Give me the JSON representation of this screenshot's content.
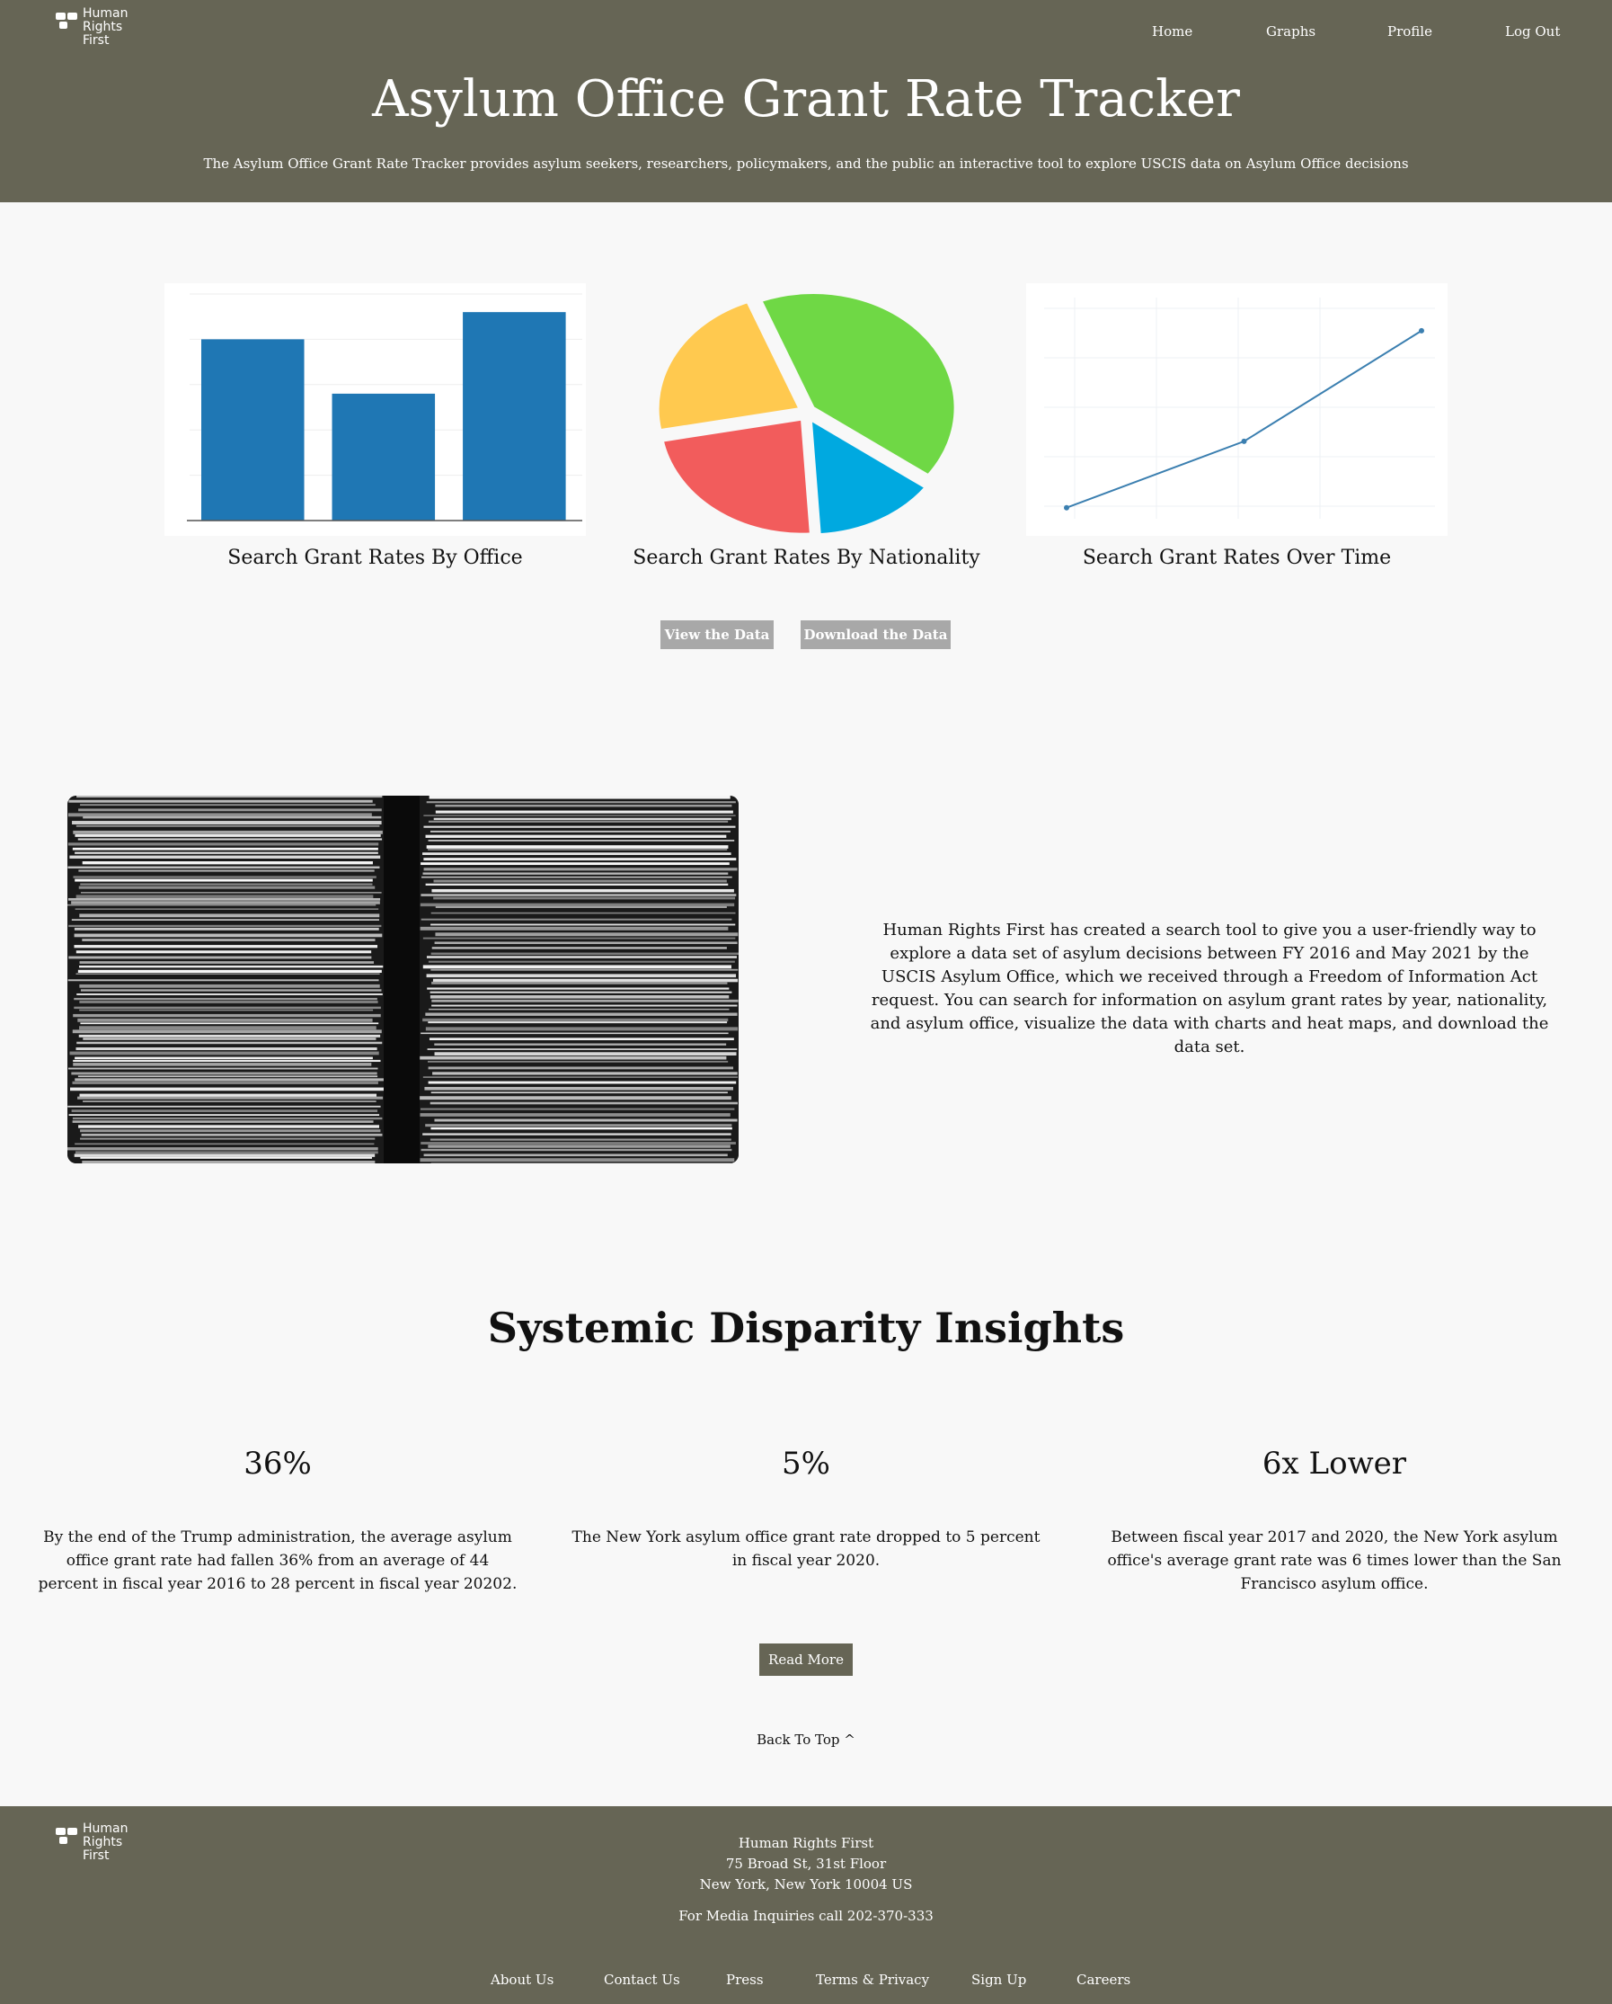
{
  "brand": {
    "logo_lines": [
      "Human",
      "Rights",
      "First"
    ]
  },
  "nav": {
    "items": [
      "Home",
      "Graphs",
      "Profile",
      "Log Out"
    ]
  },
  "hero": {
    "title": "Asylum Office Grant Rate Tracker",
    "subtitle": "The Asylum Office Grant Rate Tracker provides asylum seekers, researchers, policymakers, and the public an interactive tool to explore USCIS data on Asylum Office decisions"
  },
  "charts": {
    "office_label": "Search Grant Rates By Office",
    "nationality_label": "Search Grant Rates By Nationality",
    "time_label": "Search Grant Rates Over Time"
  },
  "chart_data": [
    {
      "type": "bar",
      "categories": [
        "",
        "",
        ""
      ],
      "values": [
        80,
        56,
        92
      ],
      "ylim": [
        0,
        100
      ],
      "grid": true,
      "colors": [
        "#1f77b4"
      ]
    },
    {
      "type": "pie",
      "values": [
        41,
        14,
        23,
        22
      ],
      "colors": [
        "#6fd845",
        "#00a9e0",
        "#f25c5c",
        "#ffc94f"
      ]
    },
    {
      "type": "line",
      "x": [
        0,
        1,
        2
      ],
      "values": [
        5,
        35,
        85
      ],
      "ylim": [
        0,
        100
      ],
      "grid": true,
      "colors": [
        "#3b7fb0"
      ]
    }
  ],
  "actions": {
    "view_data": "View the Data",
    "download_data": "Download the Data"
  },
  "about": {
    "text": "Human Rights First has created a search tool to give you a user-friendly way to explore a data set of asylum decisions between FY 2016 and May 2021 by the USCIS Asylum Office, which we received through a Freedom of Information Act request. You can search for information on asylum grant rates by year, nationality, and asylum office, visualize the data with charts and heat maps, and download the data set."
  },
  "insights": {
    "title": "Systemic Disparity Insights",
    "items": [
      {
        "stat": "36%",
        "text": "By the end of the Trump administration, the average asylum office grant rate had fallen 36% from an average of 44 percent in fiscal year 2016 to 28 percent in fiscal year 20202."
      },
      {
        "stat": "5%",
        "text": "The New York asylum office grant rate dropped to 5 percent in fiscal year 2020."
      },
      {
        "stat": "6x Lower",
        "text": "Between fiscal year 2017 and 2020, the New York asylum office's average grant rate was 6 times lower than the San Francisco asylum office."
      }
    ],
    "read_more": "Read More"
  },
  "back_to_top": "Back To Top ^",
  "footer": {
    "org": "Human Rights First",
    "address1": "75 Broad St, 31st Floor",
    "address2": "New York, New York 10004 US",
    "media": "For Media Inquiries call 202-370-333",
    "links": [
      "About Us",
      "Contact Us",
      "Press",
      "Terms & Privacy",
      "Sign Up",
      "Careers"
    ]
  }
}
